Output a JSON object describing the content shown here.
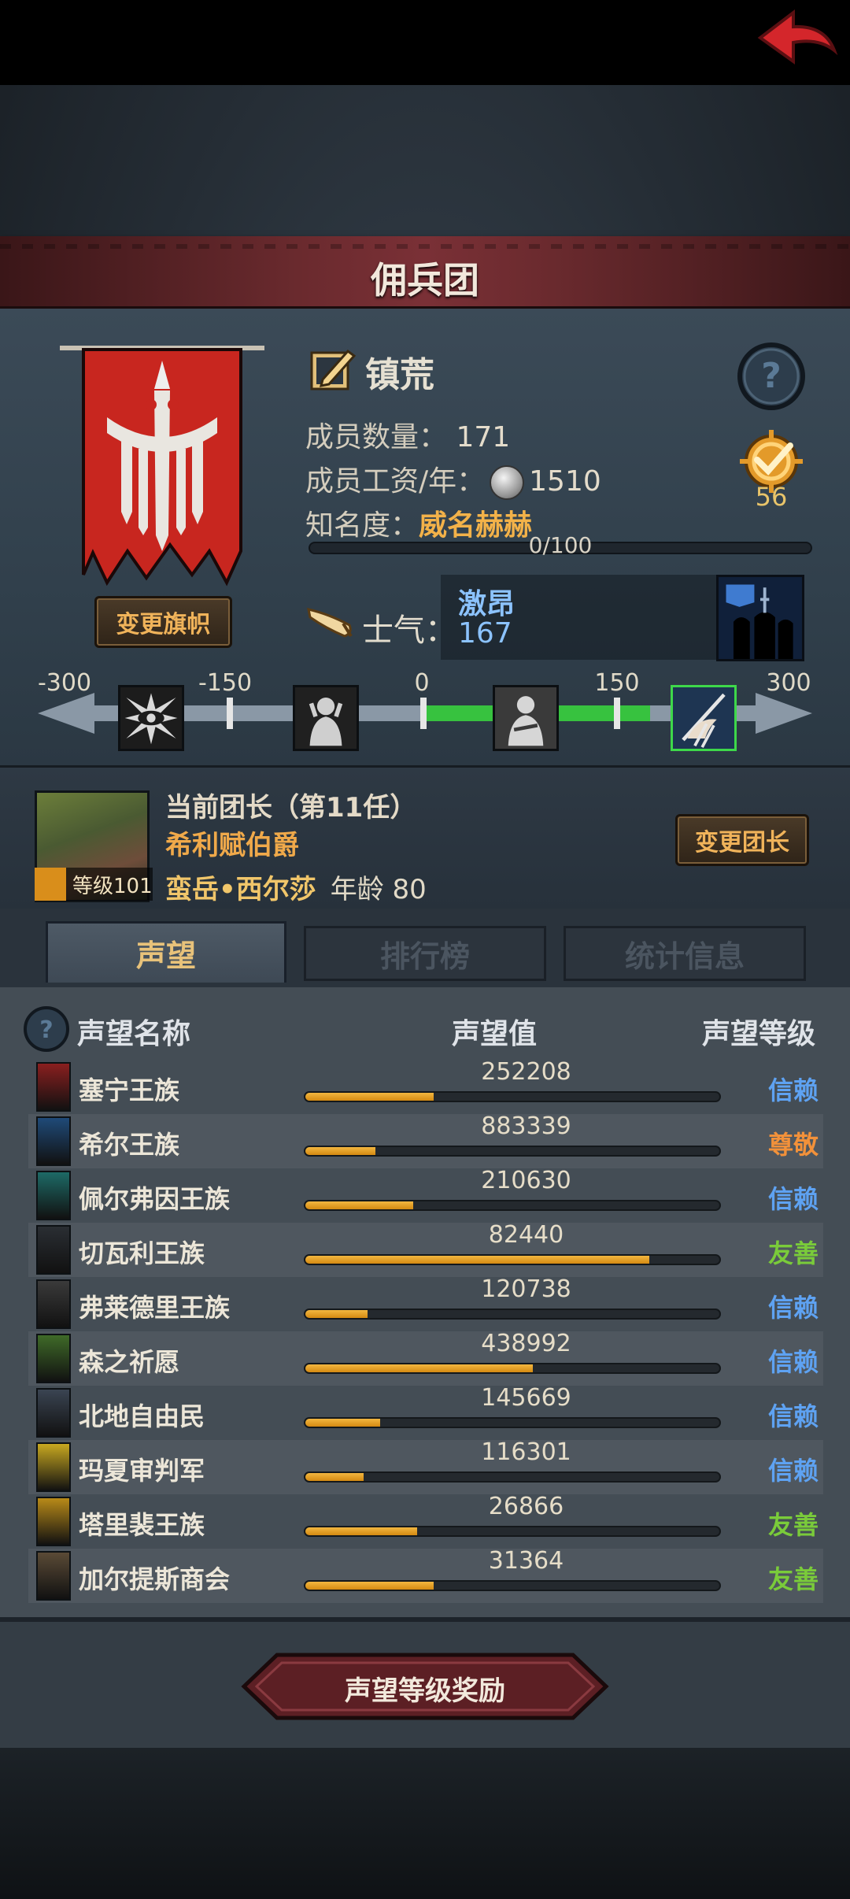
{
  "header": {
    "title": "佣兵团"
  },
  "guild": {
    "name": "镇荒",
    "members_label": "成员数量：",
    "members_value": "171",
    "salary_label": "成员工资/年：",
    "salary_value": "1510",
    "fame_label": "知名度：",
    "fame_value": "威名赫赫",
    "fame_progress": "0/100",
    "change_flag": "变更旗帜",
    "medal_count": "56"
  },
  "morale": {
    "label": "士气：",
    "state": "激昂",
    "value": "167",
    "ticks": [
      "-300",
      "-150",
      "0",
      "150",
      "300"
    ]
  },
  "commander": {
    "title": "当前团长（第11任）",
    "rank": "希利赋伯爵",
    "name": "蛮岳•西尔莎",
    "age_label": "年龄",
    "age": "80",
    "level": "等级101",
    "change_button": "变更团长"
  },
  "tabs": [
    "声望",
    "排行榜",
    "统计信息"
  ],
  "table": {
    "headers": {
      "name": "声望名称",
      "value": "声望值",
      "level": "声望等级"
    },
    "rows": [
      {
        "name": "塞宁王族",
        "value": "252208",
        "level": "信赖",
        "fill": 0.31,
        "color": "#5ea2f2",
        "icon_bg": "#8a1f1f"
      },
      {
        "name": "希尔王族",
        "value": "883339",
        "level": "尊敬",
        "fill": 0.17,
        "color": "#f2913a",
        "icon_bg": "#1f4a78"
      },
      {
        "name": "佩尔弗因王族",
        "value": "210630",
        "level": "信赖",
        "fill": 0.26,
        "color": "#5ea2f2",
        "icon_bg": "#1d6a66"
      },
      {
        "name": "切瓦利王族",
        "value": "82440",
        "level": "友善",
        "fill": 0.83,
        "color": "#7acb3a",
        "icon_bg": "#2a2e33"
      },
      {
        "name": "弗莱德里王族",
        "value": "120738",
        "level": "信赖",
        "fill": 0.15,
        "color": "#5ea2f2",
        "icon_bg": "#3a3a3a"
      },
      {
        "name": "森之祈愿",
        "value": "438992",
        "level": "信赖",
        "fill": 0.55,
        "color": "#5ea2f2",
        "icon_bg": "#3f6a28"
      },
      {
        "name": "北地自由民",
        "value": "145669",
        "level": "信赖",
        "fill": 0.18,
        "color": "#5ea2f2",
        "icon_bg": "#3a4452"
      },
      {
        "name": "玛夏审判军",
        "value": "116301",
        "level": "信赖",
        "fill": 0.14,
        "color": "#5ea2f2",
        "icon_bg": "#c8a820"
      },
      {
        "name": "塔里裴王族",
        "value": "26866",
        "level": "友善",
        "fill": 0.27,
        "color": "#7acb3a",
        "icon_bg": "#b88a18"
      },
      {
        "name": "加尔提斯商会",
        "value": "31364",
        "level": "友善",
        "fill": 0.31,
        "color": "#7acb3a",
        "icon_bg": "#5a4a36"
      }
    ]
  },
  "footer": {
    "reward_button": "声望等级奖励"
  }
}
